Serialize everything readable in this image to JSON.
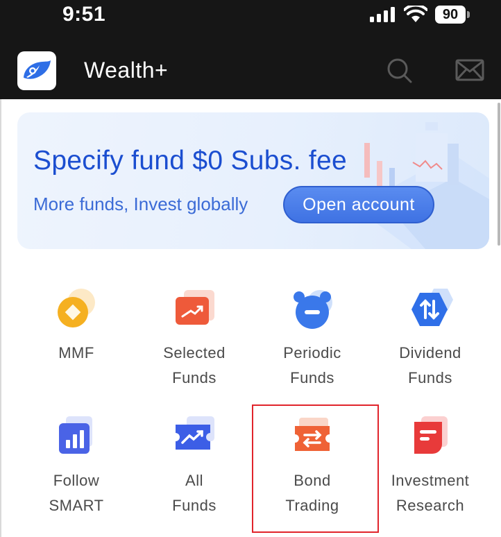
{
  "status_bar": {
    "time": "9:51",
    "battery": "90"
  },
  "app_bar": {
    "title": "Wealth+"
  },
  "banner": {
    "title": "Specify fund $0 Subs. fee",
    "subtitle": "More funds, Invest globally",
    "button_label": "Open account"
  },
  "menu": [
    {
      "label_line1": "MMF",
      "label_line2": "",
      "icon": "coin-icon"
    },
    {
      "label_line1": "Selected",
      "label_line2": "Funds",
      "icon": "trend-card-icon"
    },
    {
      "label_line1": "Periodic",
      "label_line2": "Funds",
      "icon": "alarm-clock-icon"
    },
    {
      "label_line1": "Dividend",
      "label_line2": "Funds",
      "icon": "hexagon-arrows-icon"
    },
    {
      "label_line1": "Follow",
      "label_line2": "SMART",
      "icon": "bar-chart-icon"
    },
    {
      "label_line1": "All",
      "label_line2": "Funds",
      "icon": "ticket-chart-icon"
    },
    {
      "label_line1": "Bond",
      "label_line2": "Trading",
      "icon": "exchange-ticket-icon"
    },
    {
      "label_line1": "Investment",
      "label_line2": "Research",
      "icon": "document-icon"
    }
  ],
  "colors": {
    "accent_blue": "#1b4ed0",
    "header_bg": "#161616",
    "highlight_red": "#e1242b"
  }
}
